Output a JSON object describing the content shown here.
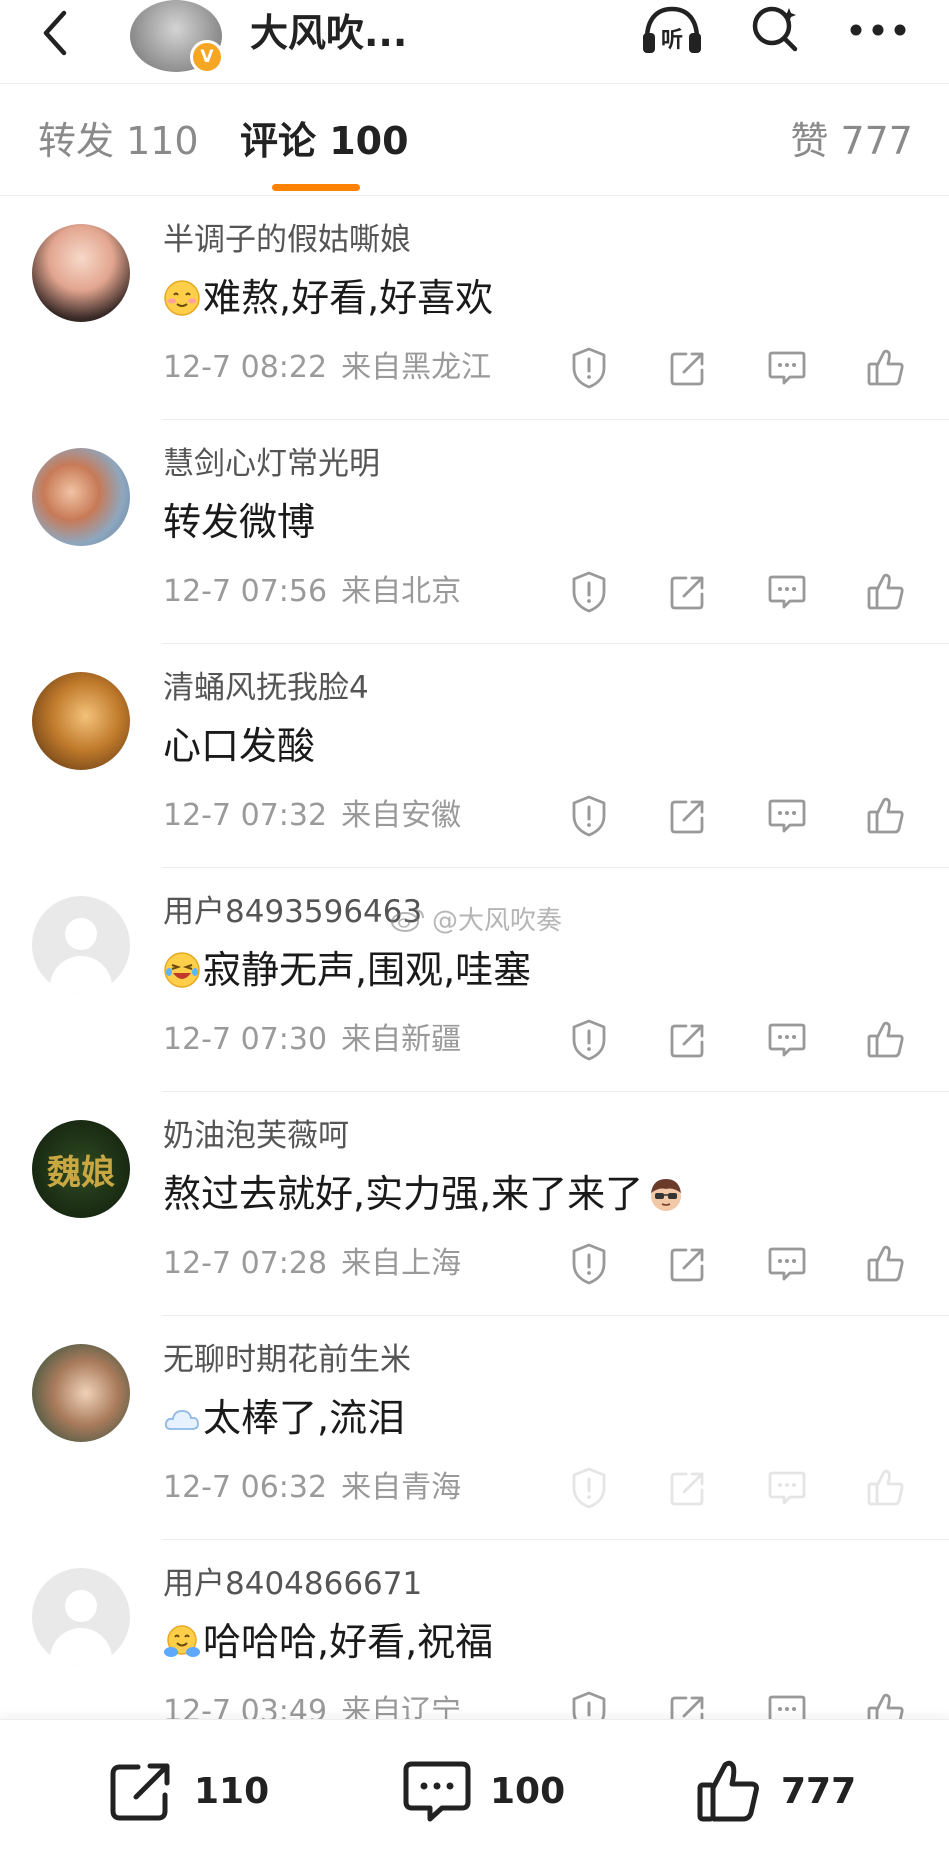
{
  "header": {
    "title": "大风吹...",
    "verified_badge": "V",
    "icons": [
      "back-icon",
      "listen-icon",
      "search-icon",
      "more-icon"
    ],
    "listen_label": "听"
  },
  "tabs": {
    "repost_label": "转发 110",
    "comments_label": "评论 100",
    "likes_label": "赞 777",
    "active": "comments",
    "accent_color": "#ff8200"
  },
  "comments": [
    {
      "name": "半调子的假姑嘶娘",
      "emoji": "smile-emoji",
      "text": "难熬,好看,好喜欢",
      "date": "12-7 08:22",
      "location": "来自黑龙江"
    },
    {
      "name": "慧剑心灯常光明",
      "emoji": "",
      "text": "转发微博",
      "date": "12-7 07:56",
      "location": "来自北京"
    },
    {
      "name": "清蛹风抚我脸4",
      "emoji": "",
      "text": "心口发酸",
      "date": "12-7 07:32",
      "location": "来自安徽"
    },
    {
      "name": "用户8493596463",
      "emoji": "laugh-cry-emoji",
      "text": "寂静无声,围观,哇塞",
      "date": "12-7 07:30",
      "location": "来自新疆"
    },
    {
      "name": "奶油泡芙薇呵",
      "emoji": "",
      "text": "熬过去就好,实力强,来了来了",
      "trailing_emoji": "cool-face-emoji",
      "date": "12-7 07:28",
      "location": "来自上海"
    },
    {
      "name": "无聊时期花前生米",
      "emoji": "cloud-emoji",
      "text": "太棒了,流泪",
      "date": "12-7 06:32",
      "location": "来自青海"
    },
    {
      "name": "用户8404866671",
      "emoji": "hug-emoji",
      "text": "哈哈哈,好看,祝福",
      "date": "12-7 03:49",
      "location": "来自辽宁"
    }
  ],
  "avatar_text": {
    "green_avatar": "魏娘"
  },
  "watermark": "@大风吹奏",
  "bottom_bar": {
    "repost_count": "110",
    "comment_count": "100",
    "like_count": "777"
  }
}
